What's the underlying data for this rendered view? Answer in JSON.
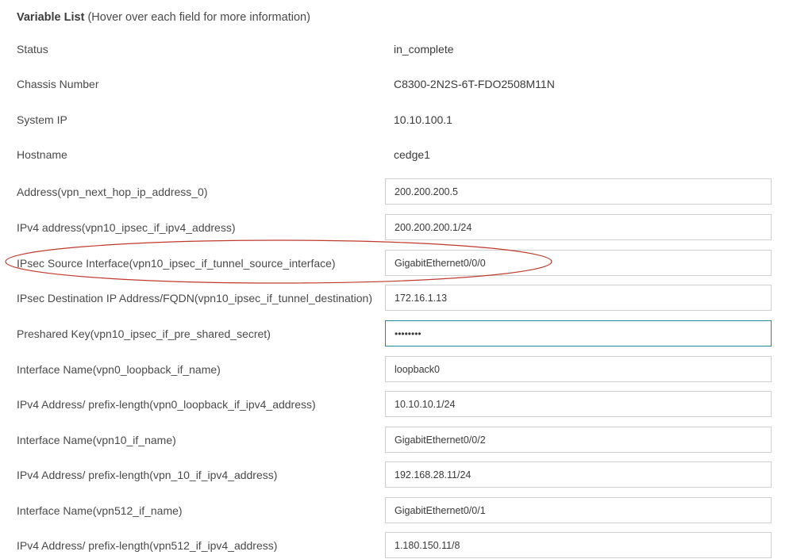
{
  "header": {
    "title": "Variable List",
    "hint": "(Hover over each field for more information)"
  },
  "static_rows": [
    {
      "label": "Status",
      "value": "in_complete"
    },
    {
      "label": "Chassis Number",
      "value": "C8300-2N2S-6T-FDO2508M11N"
    },
    {
      "label": "System IP",
      "value": "10.10.100.1"
    },
    {
      "label": "Hostname",
      "value": "cedge1"
    }
  ],
  "input_rows": [
    {
      "label": "Address(vpn_next_hop_ip_address_0)",
      "value": "200.200.200.5"
    },
    {
      "label": "IPv4 address(vpn10_ipsec_if_ipv4_address)",
      "value": "200.200.200.1/24"
    },
    {
      "label": "IPsec Source Interface(vpn10_ipsec_if_tunnel_source_interface)",
      "value": "GigabitEthernet0/0/0"
    },
    {
      "label": "IPsec Destination IP Address/FQDN(vpn10_ipsec_if_tunnel_destination)",
      "value": "172.16.1.13"
    },
    {
      "label": "Preshared Key(vpn10_ipsec_if_pre_shared_secret)",
      "value": "••••••••"
    },
    {
      "label": "Interface Name(vpn0_loopback_if_name)",
      "value": "loopback0"
    },
    {
      "label": "IPv4 Address/ prefix-length(vpn0_loopback_if_ipv4_address)",
      "value": "10.10.10.1/24"
    },
    {
      "label": "Interface Name(vpn10_if_name)",
      "value": "GigabitEthernet0/0/2"
    },
    {
      "label": "IPv4 Address/ prefix-length(vpn_10_if_ipv4_address)",
      "value": "192.168.28.11/24"
    },
    {
      "label": "Interface Name(vpn512_if_name)",
      "value": "GigabitEthernet0/0/1"
    },
    {
      "label": "IPv4 Address/ prefix-length(vpn512_if_ipv4_address)",
      "value": "1.180.150.11/8"
    }
  ],
  "colors": {
    "highlight_ellipse": "#c0392b",
    "focused_border": "#1e8a9a",
    "input_border": "#cfcfcf"
  }
}
